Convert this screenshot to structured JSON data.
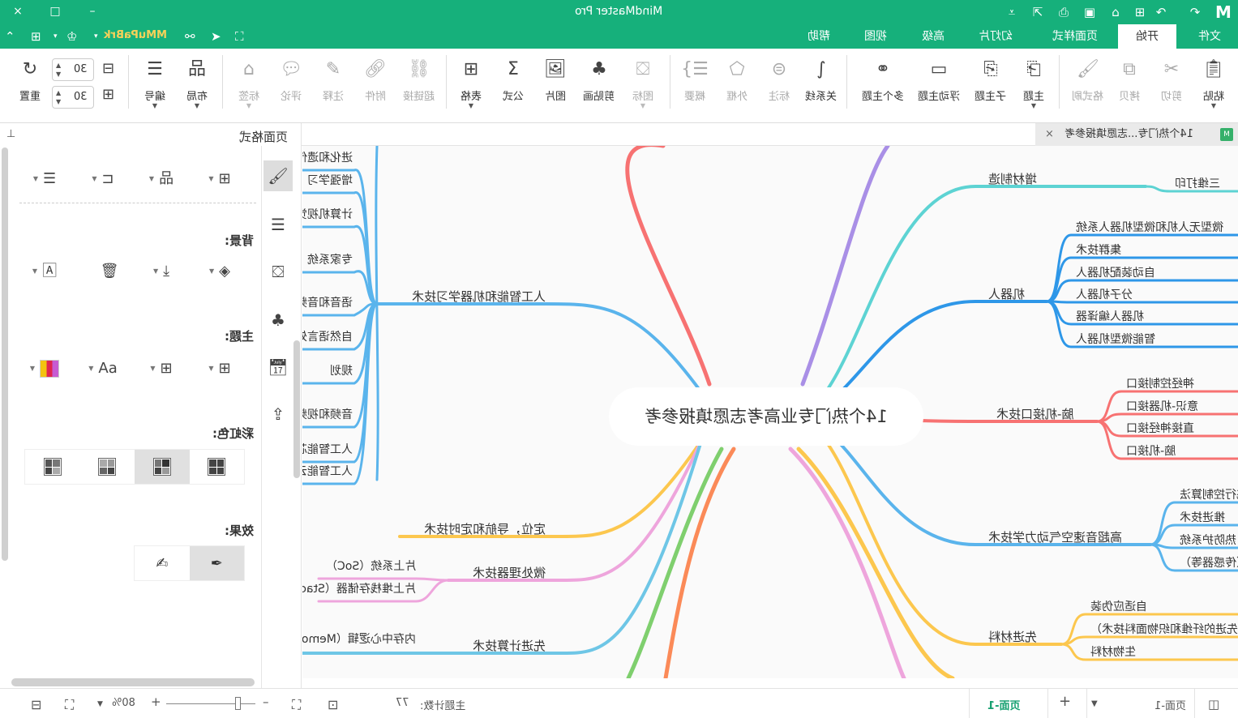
{
  "app": {
    "title": "MindMaster Pro",
    "brand_badge": "MMuPaBrk"
  },
  "window_controls": {
    "close": "×",
    "maximize": "□",
    "minimize": "–"
  },
  "quick_access": [
    "undo-icon",
    "redo-icon",
    "new-icon",
    "open-icon",
    "save-icon",
    "print-icon",
    "export-icon",
    "customize-icon"
  ],
  "menu": {
    "tabs": [
      {
        "label": "文件",
        "active": false
      },
      {
        "label": "开始",
        "active": true
      },
      {
        "label": "页面样式",
        "active": false
      },
      {
        "label": "幻灯片",
        "active": false
      },
      {
        "label": "高级",
        "active": false
      },
      {
        "label": "视图",
        "active": false
      },
      {
        "label": "帮助",
        "active": false
      }
    ]
  },
  "ribbon": {
    "clipboard": [
      {
        "label": "粘贴",
        "icon": "paste-icon",
        "enabled": true,
        "dropdown": true
      },
      {
        "label": "剪切",
        "icon": "cut-icon",
        "enabled": false
      },
      {
        "label": "拷贝",
        "icon": "copy-icon",
        "enabled": false
      },
      {
        "label": "格式刷",
        "icon": "format-painter-icon",
        "enabled": false
      }
    ],
    "topics": [
      {
        "label": "主题",
        "icon": "topic-icon",
        "enabled": true,
        "dropdown": true
      },
      {
        "label": "子主题",
        "icon": "subtopic-icon",
        "enabled": true
      },
      {
        "label": "浮动主题",
        "icon": "floating-topic-icon",
        "enabled": true
      },
      {
        "label": "多个主题",
        "icon": "multiple-topics-icon",
        "enabled": true
      }
    ],
    "insert": [
      {
        "label": "关系线",
        "icon": "relationship-icon",
        "enabled": true
      },
      {
        "label": "标注",
        "icon": "callout-icon",
        "enabled": false
      },
      {
        "label": "外框",
        "icon": "boundary-icon",
        "enabled": false
      },
      {
        "label": "概要",
        "icon": "summary-icon",
        "enabled": false
      }
    ],
    "media": [
      {
        "label": "图标",
        "icon": "icon-icon",
        "enabled": false,
        "dropdown": true
      },
      {
        "label": "剪贴画",
        "icon": "clipart-icon",
        "enabled": true
      },
      {
        "label": "图片",
        "icon": "image-icon",
        "enabled": true
      },
      {
        "label": "公式",
        "icon": "formula-icon",
        "enabled": true
      },
      {
        "label": "表格",
        "icon": "table-icon",
        "enabled": true,
        "dropdown": true
      }
    ],
    "annotations": [
      {
        "label": "超链接",
        "icon": "hyperlink-icon",
        "enabled": false
      },
      {
        "label": "附件",
        "icon": "attachment-icon",
        "enabled": false
      },
      {
        "label": "注释",
        "icon": "note-icon",
        "enabled": false
      },
      {
        "label": "评论",
        "icon": "comment-icon",
        "enabled": false
      },
      {
        "label": "标签",
        "icon": "tag-icon",
        "enabled": false,
        "dropdown": true
      }
    ],
    "layout": [
      {
        "label": "布局",
        "icon": "layout-icon",
        "enabled": true,
        "dropdown": true
      },
      {
        "label": "编号",
        "icon": "numbering-icon",
        "enabled": true,
        "dropdown": true
      }
    ],
    "spacing": {
      "horizontal_value": "30",
      "vertical_value": "30",
      "reset_label": "重置"
    }
  },
  "document_tab": {
    "name": "14个热门专...志愿填报参考",
    "close": "×"
  },
  "panel": {
    "title": "页面格式",
    "sections": {
      "background": "背景:",
      "theme": "主题:",
      "rainbow": "彩虹色:",
      "effects": "效果:"
    },
    "rainbow_selected_index": 1,
    "effects_selected_index": 0
  },
  "mindmap": {
    "root": "14个热门专业高考志愿填报参考",
    "branches_right": [
      {
        "label": "增材制造",
        "color": "#5dd3d3",
        "children": [
          "三维打印"
        ]
      },
      {
        "label": "机器人",
        "color": "#2e97e8",
        "children": [
          "微型无人机和微型机器人系统",
          "集群技术",
          "自动装配机器人",
          "分子机器人",
          "机器人编译器",
          "智能微型机器人"
        ]
      },
      {
        "label": "脑-机接口技术",
        "color": "#f77272",
        "children": [
          "神经控制接口",
          "意识-机器接口",
          "直接神经接口",
          "脑-机接口"
        ]
      },
      {
        "label": "高超音速空气动力学技术",
        "color": "#5ab4ec",
        "children": [
          "飞行控制算法",
          "推进技术",
          "热防护系统",
          "（传感器等）"
        ]
      },
      {
        "label": "先进材料",
        "color": "#fcc74e",
        "children": [
          "自适应伪装",
          "（先进的纤维和织物面料技术）",
          "生物材料"
        ]
      }
    ],
    "branches_left": [
      {
        "label": "人工智能和机器学习技术",
        "color": "#5ab4ec",
        "children": [
          "进化和遗传计算",
          "增强学习",
          "计算机视觉",
          "专家系统",
          "语音和音频处理",
          "自然语言处理",
          "规划",
          "音频和视频处理",
          "人工智能芯片",
          "人工智能云"
        ]
      },
      {
        "label": "定位，导航和定时技术",
        "color": "#fcc74e",
        "children": []
      },
      {
        "label": "微处理器技术",
        "color": "#eea5dc",
        "children": [
          "片上系统（SoC）",
          "片上堆栈存储器（Stacked Memory on Chip）"
        ]
      },
      {
        "label": "先进计算技术",
        "color": "#6ec6e6",
        "children": [
          "内存中心逻辑（Memory-Centric Logic）"
        ]
      }
    ],
    "offscreen_branch_colors": [
      "#f77272",
      "#a98fe6",
      "#7fcf6e",
      "#fb8a58",
      "#eea5dc",
      "#fcc74e"
    ]
  },
  "statusbar": {
    "page_label": "页面-1",
    "active_page_tab": "页面-1",
    "add_page": "+",
    "topic_count_label": "主题计数:",
    "topic_count": "77",
    "zoom_percent": "80%",
    "zoom_fraction": 0.8
  }
}
